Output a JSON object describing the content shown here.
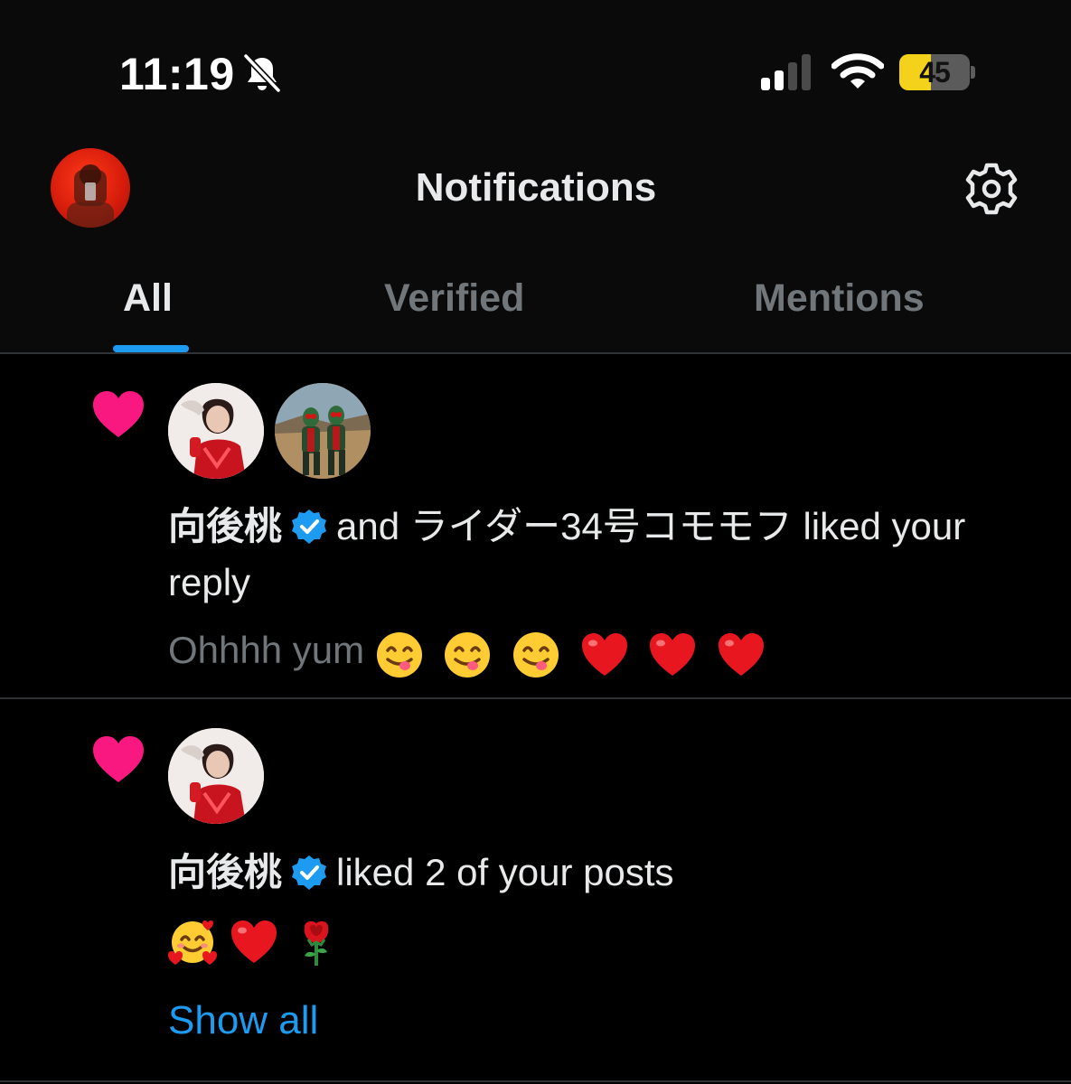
{
  "status_bar": {
    "time": "11:19",
    "battery_level": "45",
    "battery_fraction": 0.45,
    "icons": [
      "bell-slash-icon",
      "cellular-signal-icon",
      "wifi-icon",
      "battery-icon"
    ]
  },
  "header": {
    "title": "Notifications",
    "settings_icon": "gear-icon"
  },
  "tabs": [
    {
      "label": "All",
      "active": true
    },
    {
      "label": "Verified",
      "active": false
    },
    {
      "label": "Mentions",
      "active": false
    }
  ],
  "notifications": [
    {
      "type_icon": "heart-icon",
      "name": "向後桃",
      "action": "and ライダー34号コモモフ liked your reply",
      "preview_text": "Ohhhh yum",
      "preview_emojis": [
        "face-savoring-food-emoji",
        "face-savoring-food-emoji",
        "face-savoring-food-emoji",
        "red-heart-emoji",
        "red-heart-emoji",
        "red-heart-emoji"
      ]
    },
    {
      "type_icon": "heart-icon",
      "name": "向後桃",
      "action": "liked 2 of your posts",
      "preview_emojis": [
        "smiling-face-with-hearts-emoji",
        "red-heart-emoji",
        "rose-emoji"
      ],
      "show_all_label": "Show all"
    }
  ],
  "colors": {
    "accent": "#1d9bf0",
    "like": "#f91880",
    "muted": "#71767b",
    "battery": "#f4d21b"
  }
}
